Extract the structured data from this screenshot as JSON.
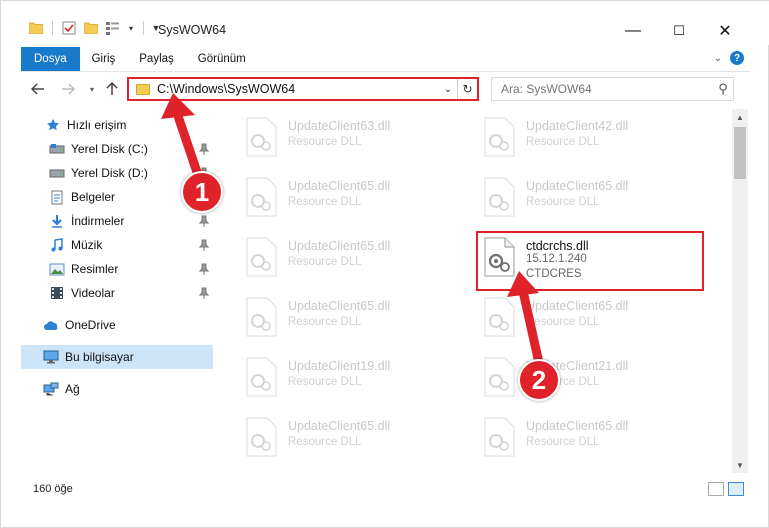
{
  "window": {
    "title": "SysWOW64",
    "minimize_label": "—",
    "maximize_label": "☐",
    "close_label": "✕"
  },
  "ribbon": {
    "tabs": [
      {
        "label": "Dosya",
        "active": true
      },
      {
        "label": "Giriş",
        "active": false
      },
      {
        "label": "Paylaş",
        "active": false
      },
      {
        "label": "Görünüm",
        "active": false
      }
    ]
  },
  "address": {
    "path": "C:\\Windows\\SysWOW64"
  },
  "search": {
    "placeholder": "Ara: SysWOW64"
  },
  "sidebar": {
    "items": [
      {
        "label": "Hızlı erişim",
        "icon": "star-icon",
        "pinned": false
      },
      {
        "label": "Yerel Disk (C:)",
        "icon": "drive-icon",
        "pinned": true
      },
      {
        "label": "Yerel Disk (D:)",
        "icon": "drive-icon",
        "pinned": true
      },
      {
        "label": "Belgeler",
        "icon": "documents-icon",
        "pinned": true
      },
      {
        "label": "İndirmeler",
        "icon": "download-icon",
        "pinned": true
      },
      {
        "label": "Müzik",
        "icon": "music-icon",
        "pinned": true
      },
      {
        "label": "Resimler",
        "icon": "pictures-icon",
        "pinned": true
      },
      {
        "label": "Videolar",
        "icon": "videos-icon",
        "pinned": true
      },
      {
        "label": "OneDrive",
        "icon": "cloud-icon",
        "pinned": false
      },
      {
        "label": "Bu bilgisayar",
        "icon": "computer-icon",
        "pinned": false,
        "selected": true
      },
      {
        "label": "Ağ",
        "icon": "network-icon",
        "pinned": false
      }
    ]
  },
  "files": {
    "left": [
      {
        "name": "UpdateClient63.dll",
        "desc": "Resource DLL"
      },
      {
        "name": "UpdateClient65.dll",
        "desc": "Resource DLL"
      },
      {
        "name": "UpdateClient65.dll",
        "desc": "Resource DLL"
      },
      {
        "name": "UpdateClient65.dll",
        "desc": "Resource DLL"
      },
      {
        "name": "UpdateClient19.dll",
        "desc": "Resource DLL"
      },
      {
        "name": "UpdateClient65.dll",
        "desc": "Resource DLL"
      }
    ],
    "right": [
      {
        "name": "UpdateClient42.dll",
        "desc": "Resource DLL"
      },
      {
        "name": "UpdateClient65.dll",
        "desc": "Resource DLL"
      },
      {
        "name": "ctdcrchs.dll",
        "desc": "15.12.1.240",
        "desc2": "CTDCRES",
        "highlighted": true
      },
      {
        "name": "UpdateClient65.dll",
        "desc": "Resource DLL"
      },
      {
        "name": "UpdateClient21.dll",
        "desc": "Resource DLL"
      },
      {
        "name": "UpdateClient65.dll",
        "desc": "Resource DLL"
      }
    ]
  },
  "status": {
    "count": "160 öğe"
  },
  "callouts": {
    "one": "1",
    "two": "2"
  },
  "colors": {
    "accent": "#1979ca",
    "highlight_red": "#e0232b",
    "selected_bg": "#cce4f7"
  }
}
